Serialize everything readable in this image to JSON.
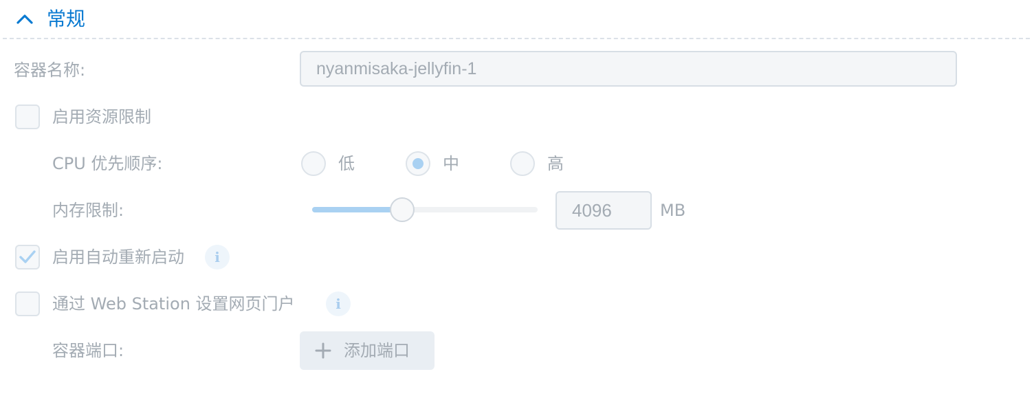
{
  "section": {
    "title": "常规"
  },
  "container_name": {
    "label": "容器名称:",
    "value": "nyanmisaka-jellyfin-1"
  },
  "resource_limit": {
    "label": "启用资源限制",
    "checked": false
  },
  "cpu_priority": {
    "label": "CPU 优先顺序:",
    "options": [
      "低",
      "中",
      "高"
    ],
    "selected": "中"
  },
  "memory_limit": {
    "label": "内存限制:",
    "value": "4096",
    "unit": "MB",
    "slider_fraction": 0.4
  },
  "auto_restart": {
    "label": "启用自动重新启动",
    "checked": true
  },
  "web_station": {
    "label": "通过 Web Station 设置网页门户",
    "checked": false
  },
  "container_port": {
    "label": "容器端口:",
    "add_button_label": "添加端口"
  },
  "colors": {
    "accent": "#0a7ad1",
    "accent_light": "#a9d1f2",
    "muted_text": "#a3abb3"
  },
  "icons": [
    "chevron-up-icon",
    "checkmark-icon",
    "info-icon",
    "plus-icon"
  ]
}
